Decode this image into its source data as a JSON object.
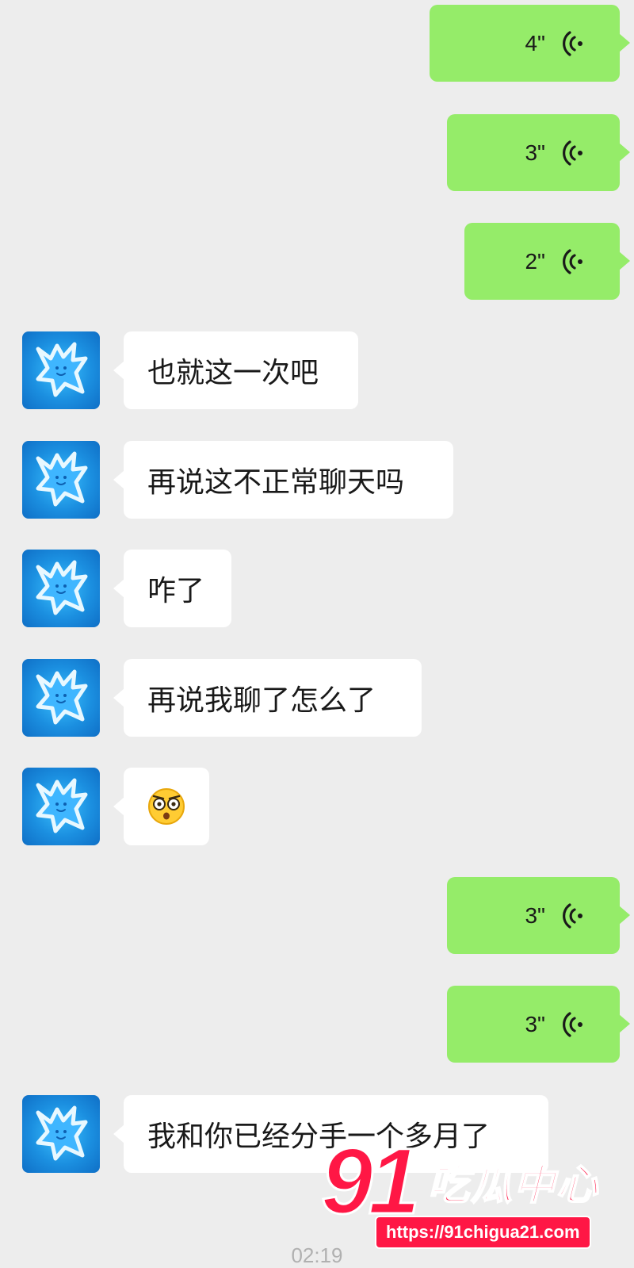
{
  "voice_messages_top": [
    {
      "duration": "4\""
    },
    {
      "duration": "3\""
    },
    {
      "duration": "2\""
    }
  ],
  "incoming_messages": [
    {
      "text": "也就这一次吧"
    },
    {
      "text": "再说这不正常聊天吗"
    },
    {
      "text": "咋了"
    },
    {
      "text": "再说我聊了怎么了"
    },
    {
      "emoji": "astonished-face"
    }
  ],
  "voice_messages_bottom": [
    {
      "duration": "3\""
    },
    {
      "duration": "3\""
    }
  ],
  "last_incoming": {
    "text": "我和你已经分手一个多月了"
  },
  "timestamp": "02:19",
  "watermark": {
    "number": "91",
    "title": "吃瓜中心",
    "url": "https://91chigua21.com"
  },
  "colors": {
    "background": "#ededed",
    "outgoing_bubble": "#95ec69",
    "incoming_bubble": "#ffffff",
    "watermark_red": "#ff1745"
  }
}
